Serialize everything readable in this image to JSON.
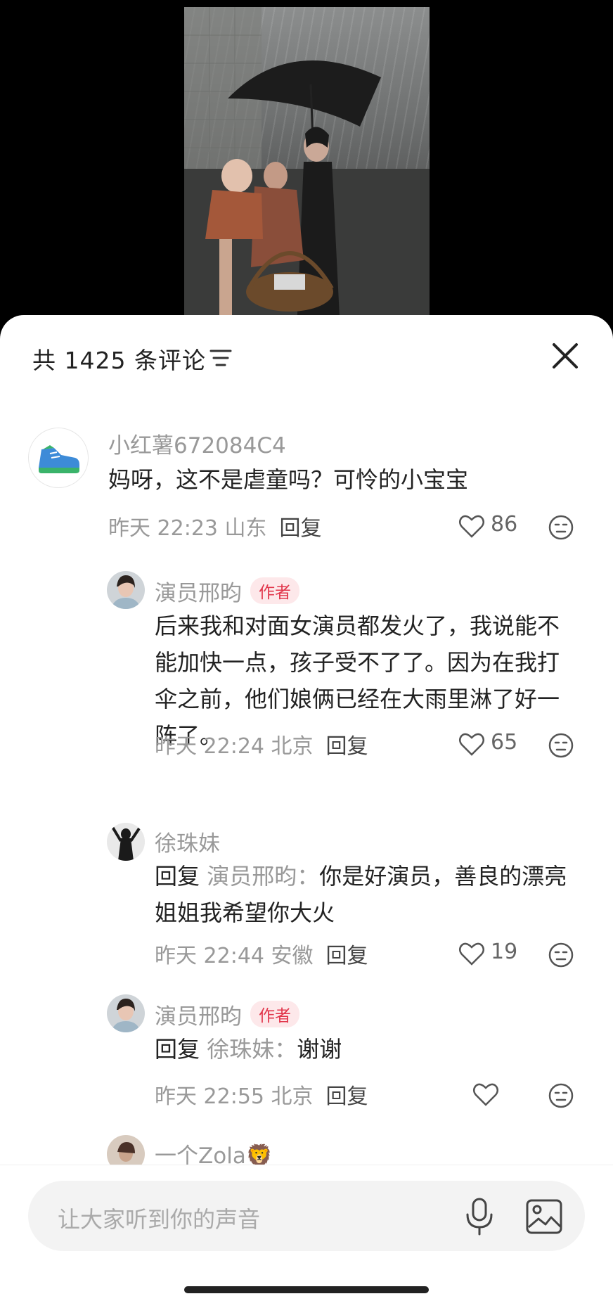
{
  "header": {
    "comment_count": "共 1425 条评论"
  },
  "comments": [
    {
      "username": "小红薯672084C4",
      "content": "妈呀，这不是虐童吗？可怜的小宝宝",
      "meta": "昨天 22:23 山东",
      "reply_label": "回复",
      "likes": "86",
      "avatar_icon": "sneaker-icon"
    },
    {
      "username": "演员邢昀",
      "badge": "作者",
      "content": "后来我和对面女演员都发火了，我说能不能加快一点，孩子受不了了。因为在我打伞之前，他们娘俩已经在大雨里淋了好一阵了。",
      "meta": "昨天 22:24 北京",
      "reply_label": "回复",
      "likes": "65"
    },
    {
      "username": "徐珠妹",
      "reply_word": "回复",
      "reply_to": "演员邢昀：",
      "content": "你是好演员，善良的漂亮姐姐我希望你大火",
      "meta": "昨天 22:44 安徽",
      "reply_label": "回复",
      "likes": "19"
    },
    {
      "username": "演员邢昀",
      "badge": "作者",
      "reply_word": "回复",
      "reply_to": "徐珠妹：",
      "content": "谢谢",
      "meta": "昨天 22:55 北京",
      "reply_label": "回复",
      "likes": ""
    },
    {
      "username": "一个Zola🦁"
    }
  ],
  "input": {
    "placeholder": "让大家听到你的声音"
  },
  "colors": {
    "author_badge_bg": "#fde8ea",
    "author_badge_text": "#e1354a",
    "meta_text": "#999999"
  }
}
